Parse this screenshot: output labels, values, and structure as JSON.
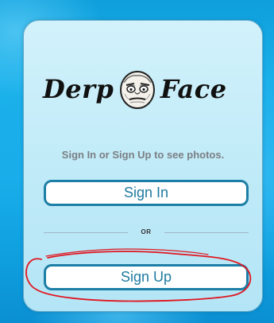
{
  "brand": {
    "name_left": "Derp",
    "name_right": "Face",
    "face_icon": "rage-face-icon"
  },
  "tagline": "Sign In or Sign Up to see photos.",
  "buttons": {
    "sign_in": "Sign In",
    "sign_up": "Sign Up"
  },
  "divider_text": "OR",
  "colors": {
    "background": "#19aeea",
    "card": "#c7eef9",
    "button_border": "#1d7fa6",
    "button_text": "#1e7aa0",
    "annotation": "#e0161f"
  }
}
